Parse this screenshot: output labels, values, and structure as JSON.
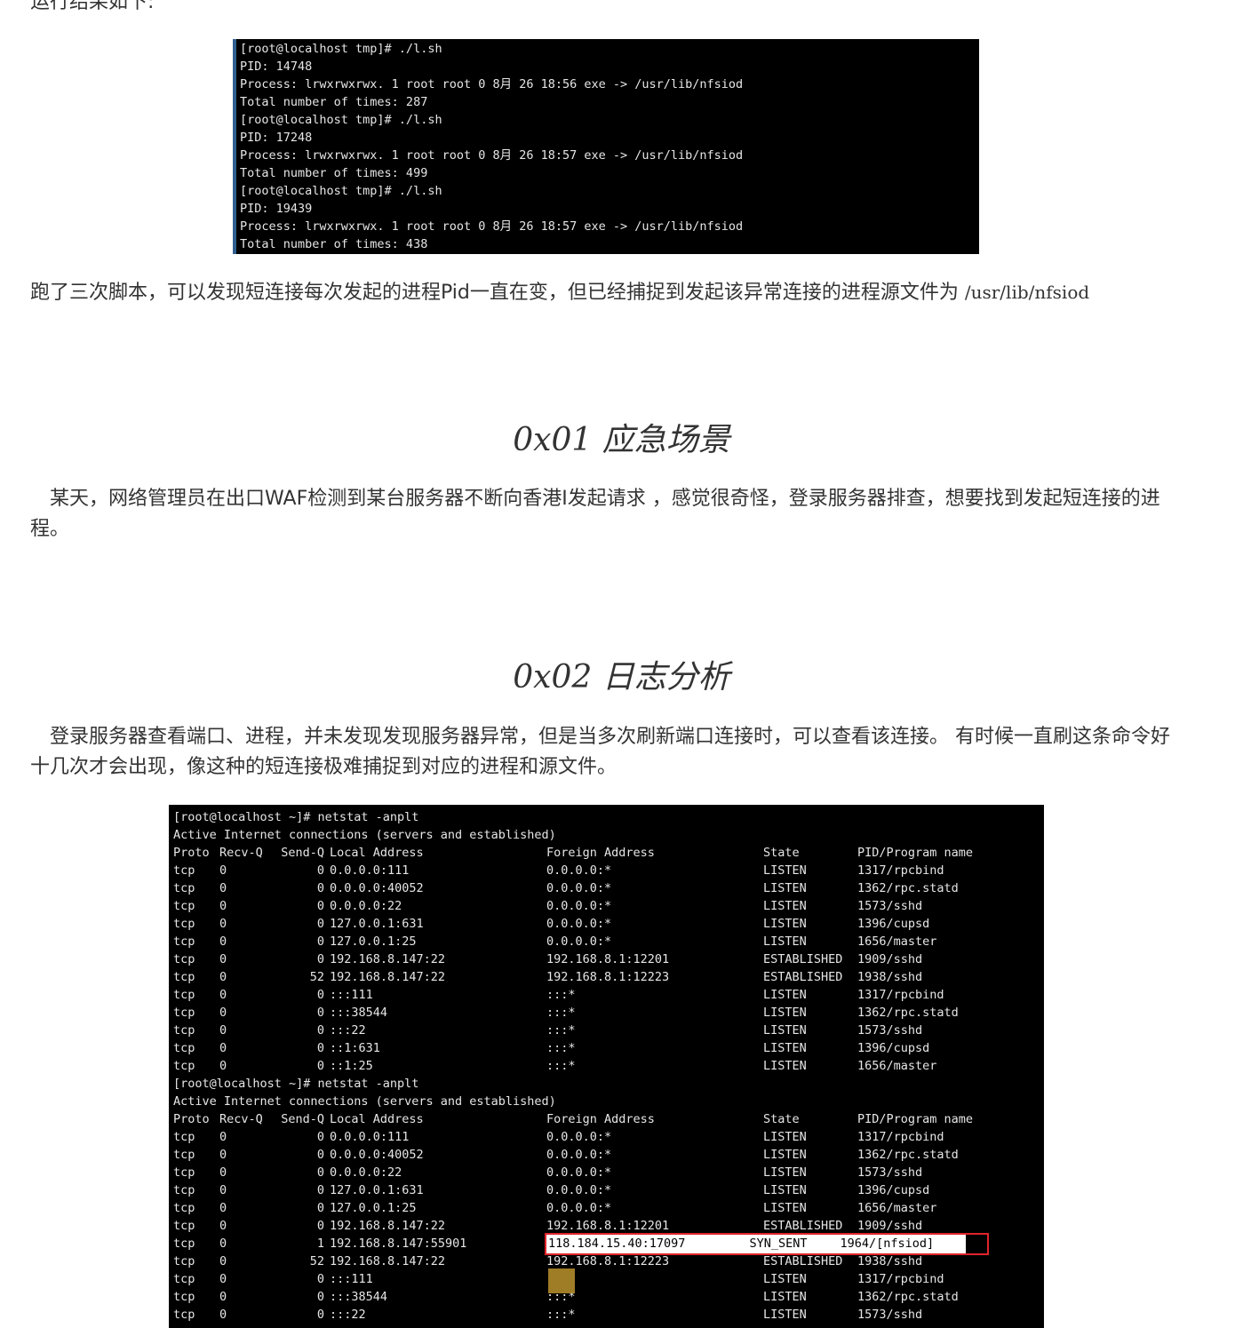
{
  "intro_text": "运行结果如下:",
  "terminal1": {
    "lines": [
      "[root@localhost tmp]# ./l.sh",
      "PID: 14748",
      "Process: lrwxrwxrwx. 1 root root 0 8月 26 18:56 exe -> /usr/lib/nfsiod",
      "Total number of times: 287",
      "[root@localhost tmp]# ./l.sh",
      "PID: 17248",
      "Process: lrwxrwxrwx. 1 root root 0 8月 26 18:57 exe -> /usr/lib/nfsiod",
      "Total number of times: 499",
      "[root@localhost tmp]# ./l.sh",
      "PID: 19439",
      "Process: lrwxrwxrwx. 1 root root 0 8月 26 18:57 exe -> /usr/lib/nfsiod",
      "Total number of times: 438"
    ]
  },
  "summary": {
    "text": "跑了三次脚本，可以发现短连接每次发起的进程Pid一直在变，但已经捕捉到发起该异常连接的进程源文件为 ",
    "path": "/usr/lib/nfsiod"
  },
  "section1": {
    "heading": "0x01 应急场景",
    "body": "某天，网络管理员在出口WAF检测到某台服务器不断向香港I发起请求 ，感觉很奇怪，登录服务器排查，想要找到发起短连接的进程。"
  },
  "section2": {
    "heading": "0x02 日志分析",
    "body": "登录服务器查看端口、进程，并未发现发现服务器异常，但是当多次刷新端口连接时，可以查看该连接。 有时候一直刷这条命令好十几次才会出现，像这种的短连接极难捕捉到对应的进程和源文件。"
  },
  "terminal2": {
    "block1": {
      "prompt": "[root@localhost ~]# netstat -anplt",
      "title": "Active Internet connections (servers and established)",
      "header": [
        "Proto",
        "Recv-Q",
        "Send-Q",
        "Local Address",
        "Foreign Address",
        "State",
        "PID/Program name"
      ],
      "rows": [
        [
          "tcp",
          "0",
          "0",
          "0.0.0.0:111",
          "0.0.0.0:*",
          "LISTEN",
          "1317/rpcbind"
        ],
        [
          "tcp",
          "0",
          "0",
          "0.0.0.0:40052",
          "0.0.0.0:*",
          "LISTEN",
          "1362/rpc.statd"
        ],
        [
          "tcp",
          "0",
          "0",
          "0.0.0.0:22",
          "0.0.0.0:*",
          "LISTEN",
          "1573/sshd"
        ],
        [
          "tcp",
          "0",
          "0",
          "127.0.0.1:631",
          "0.0.0.0:*",
          "LISTEN",
          "1396/cupsd"
        ],
        [
          "tcp",
          "0",
          "0",
          "127.0.0.1:25",
          "0.0.0.0:*",
          "LISTEN",
          "1656/master"
        ],
        [
          "tcp",
          "0",
          "0",
          "192.168.8.147:22",
          "192.168.8.1:12201",
          "ESTABLISHED",
          "1909/sshd"
        ],
        [
          "tcp",
          "0",
          "52",
          "192.168.8.147:22",
          "192.168.8.1:12223",
          "ESTABLISHED",
          "1938/sshd"
        ],
        [
          "tcp",
          "0",
          "0",
          ":::111",
          ":::*",
          "LISTEN",
          "1317/rpcbind"
        ],
        [
          "tcp",
          "0",
          "0",
          ":::38544",
          ":::*",
          "LISTEN",
          "1362/rpc.statd"
        ],
        [
          "tcp",
          "0",
          "0",
          ":::22",
          ":::*",
          "LISTEN",
          "1573/sshd"
        ],
        [
          "tcp",
          "0",
          "0",
          "::1:631",
          ":::*",
          "LISTEN",
          "1396/cupsd"
        ],
        [
          "tcp",
          "0",
          "0",
          "::1:25",
          ":::*",
          "LISTEN",
          "1656/master"
        ]
      ]
    },
    "block2": {
      "prompt": "[root@localhost ~]# netstat -anplt",
      "title": "Active Internet connections (servers and established)",
      "header": [
        "Proto",
        "Recv-Q",
        "Send-Q",
        "Local Address",
        "Foreign Address",
        "State",
        "PID/Program name"
      ],
      "rows": [
        [
          "tcp",
          "0",
          "0",
          "0.0.0.0:111",
          "0.0.0.0:*",
          "LISTEN",
          "1317/rpcbind"
        ],
        [
          "tcp",
          "0",
          "0",
          "0.0.0.0:40052",
          "0.0.0.0:*",
          "LISTEN",
          "1362/rpc.statd"
        ],
        [
          "tcp",
          "0",
          "0",
          "0.0.0.0:22",
          "0.0.0.0:*",
          "LISTEN",
          "1573/sshd"
        ],
        [
          "tcp",
          "0",
          "0",
          "127.0.0.1:631",
          "0.0.0.0:*",
          "LISTEN",
          "1396/cupsd"
        ],
        [
          "tcp",
          "0",
          "0",
          "127.0.0.1:25",
          "0.0.0.0:*",
          "LISTEN",
          "1656/master"
        ],
        [
          "tcp",
          "0",
          "0",
          "192.168.8.147:22",
          "192.168.8.1:12201",
          "ESTABLISHED",
          "1909/sshd"
        ],
        [
          "tcp",
          "0",
          "1",
          "192.168.8.147:55901",
          "",
          "",
          ""
        ],
        [
          "tcp",
          "0",
          "52",
          "192.168.8.147:22",
          "192.168.8.1:12223",
          "ESTABLISHED",
          "1938/sshd"
        ],
        [
          "tcp",
          "0",
          "0",
          ":::111",
          "",
          "LISTEN",
          "1317/rpcbind"
        ],
        [
          "tcp",
          "0",
          "0",
          ":::38544",
          ":::*",
          "LISTEN",
          "1362/rpc.statd"
        ],
        [
          "tcp",
          "0",
          "0",
          ":::22",
          ":::*",
          "LISTEN",
          "1573/sshd"
        ]
      ]
    },
    "highlight": {
      "foreign": "118.184.15.40:17097",
      "state": "SYN_SENT",
      "pid": "1964/[nfsiod]",
      "color": "#e0242b"
    }
  }
}
